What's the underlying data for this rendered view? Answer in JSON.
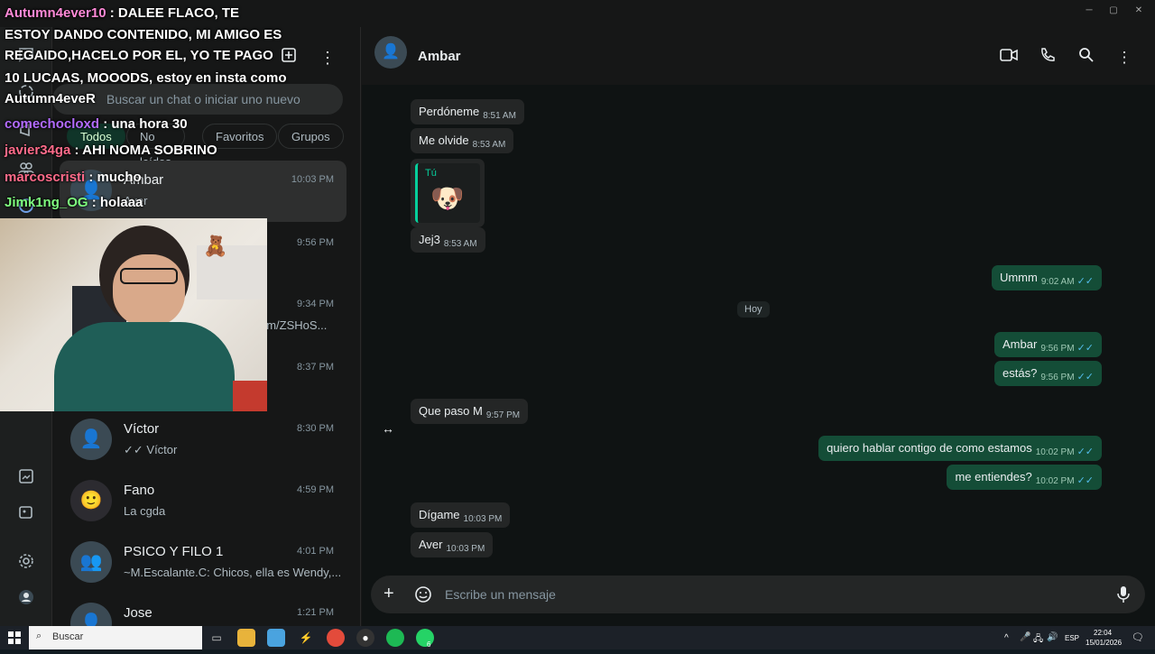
{
  "window": {
    "minimize": "─",
    "maximize": "▢",
    "close": "✕"
  },
  "left_rail": {
    "icons": [
      "chat-icon",
      "status-icon",
      "channels-icon",
      "communities-icon",
      "meta-ai-icon",
      "media-icon",
      "settings-icon",
      "profile-icon"
    ],
    "badge_count": "6"
  },
  "chat_list": {
    "search_placeholder": "Buscar un chat o iniciar uno nuevo",
    "filters": [
      "Todos",
      "No leídos",
      "Favoritos",
      "Grupos"
    ],
    "chats": [
      {
        "name": "Ambar",
        "time": "10:03 PM",
        "preview": "Aver",
        "selected": true
      },
      {
        "name": "",
        "time": "9:56 PM",
        "preview": ""
      },
      {
        "name": "",
        "time": "9:34 PM",
        "preview": "om/ZSHoS..."
      },
      {
        "name": "",
        "time": "8:37 PM",
        "preview": ""
      },
      {
        "name": "Víctor",
        "time": "8:30 PM",
        "preview": "✓✓ Víctor"
      },
      {
        "name": "Fano",
        "time": "4:59 PM",
        "preview": "La cgda"
      },
      {
        "name": "PSICO Y FILO 1",
        "time": "4:01 PM",
        "preview": "~M.Escalante.C: Chicos, ella es Wendy,..."
      },
      {
        "name": "Jose",
        "time": "1:21 PM",
        "preview": ""
      }
    ]
  },
  "conversation": {
    "contact_name": "Ambar",
    "day_label": "Hoy",
    "reply_label": "Tú",
    "messages": [
      {
        "dir": "in",
        "text": "Perdóneme",
        "time": "8:51 AM"
      },
      {
        "dir": "in",
        "text": "Me olvide",
        "time": "8:53 AM"
      },
      {
        "dir": "in",
        "text": "Jej3",
        "time": "8:53 AM"
      },
      {
        "dir": "out",
        "text": "Ummm",
        "time": "9:02 AM"
      },
      {
        "dir": "out",
        "text": "Ambar",
        "time": "9:56 PM"
      },
      {
        "dir": "out",
        "text": "estás?",
        "time": "9:56 PM"
      },
      {
        "dir": "in",
        "text": "Que paso M",
        "time": "9:57 PM"
      },
      {
        "dir": "out",
        "text": "quiero hablar contigo de como estamos",
        "time": "10:02 PM"
      },
      {
        "dir": "out",
        "text": "me entiendes?",
        "time": "10:02 PM"
      },
      {
        "dir": "in",
        "text": "Dígame",
        "time": "10:03 PM"
      },
      {
        "dir": "in",
        "text": "Aver",
        "time": "10:03 PM"
      }
    ],
    "composer_placeholder": "Escribe un mensaje",
    "tick": "✓✓"
  },
  "stream_chat": [
    {
      "user": "Autumn4ever10",
      "text": " : DALEE FLACO, TE",
      "color": "#ff8ad8"
    },
    {
      "user": "",
      "text": "ESTOY DANDO CONTENIDO, MI AMIGO ES",
      "color": "#ffffff"
    },
    {
      "user": "",
      "text": "REGAIDO,HACELO POR EL, YO TE PAGO",
      "color": "#ffffff"
    },
    {
      "user": "",
      "text": "10 LUCAAS, MOOODS, estoy en insta como",
      "color": "#ffffff"
    },
    {
      "user": "",
      "text": "Autumn4eveR",
      "color": "#ffffff"
    },
    {
      "user": "comechocloxd",
      "text": " : una hora 30",
      "color": "#b26bff"
    },
    {
      "user": "javier34ga",
      "text": " : AHI NOMA SOBRINO",
      "color": "#ff6b8a"
    },
    {
      "user": "marcoscristi",
      "text": " : mucho",
      "color": "#ff6b8a"
    },
    {
      "user": "Jimk1ng_OG",
      "text": " : holaaa",
      "color": "#7fff7f"
    }
  ],
  "taskbar": {
    "search_label": "Buscar",
    "lang": "ESP",
    "clock_time": "22:04",
    "clock_date": "15/01/2026",
    "whatsapp_badge": "6"
  },
  "colors": {
    "accent_green": "#103529",
    "out_bubble": "#144d37",
    "in_bubble": "#242626",
    "read_tick": "#53bdeb"
  }
}
